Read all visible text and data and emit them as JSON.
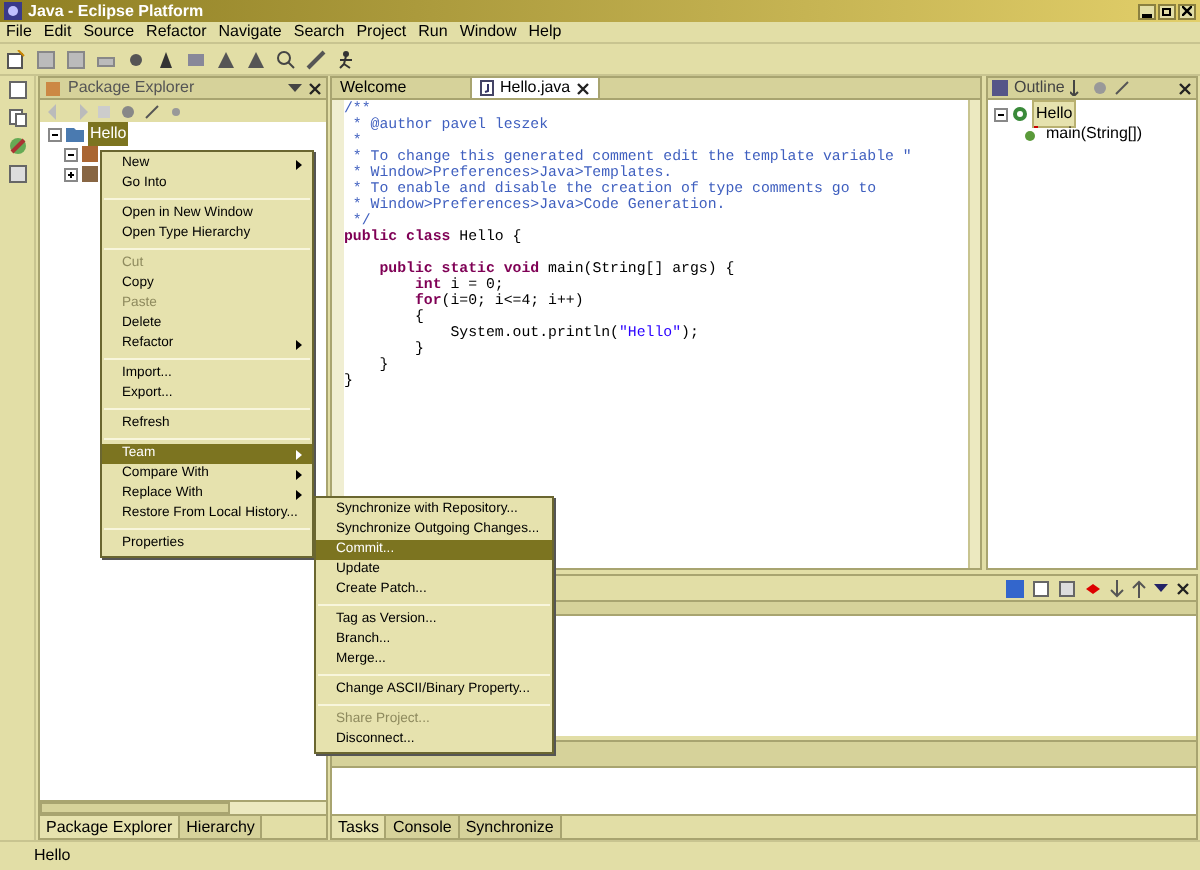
{
  "window": {
    "title": "Java - Eclipse Platform"
  },
  "menu_bar": [
    "File",
    "Edit",
    "Source",
    "Refactor",
    "Navigate",
    "Search",
    "Project",
    "Run",
    "Window",
    "Help"
  ],
  "package_explorer": {
    "title": "Package Explorer",
    "tree": [
      {
        "label": "Hello",
        "selected": true,
        "expanded": true
      }
    ],
    "tabs": [
      {
        "label": "Package Explorer",
        "selected": true
      },
      {
        "label": "Hierarchy",
        "selected": false
      }
    ]
  },
  "editor": {
    "tabs": [
      {
        "label": "Welcome",
        "selected": false
      },
      {
        "label": "Hello.java",
        "selected": true
      }
    ],
    "lines": [
      {
        "kind": "code",
        "segments": [
          {
            "kind": "comment",
            "text": "/**"
          }
        ]
      },
      {
        "kind": "code",
        "segments": [
          {
            "kind": "comment",
            "text": " * @author pavel leszek"
          }
        ]
      },
      {
        "kind": "code",
        "segments": [
          {
            "kind": "comment",
            "text": " *"
          }
        ]
      },
      {
        "kind": "code",
        "segments": [
          {
            "kind": "comment",
            "text": " * To change this generated comment edit the template variable \""
          }
        ]
      },
      {
        "kind": "code",
        "segments": [
          {
            "kind": "comment",
            "text": " * Window>Preferences>Java>Templates."
          }
        ]
      },
      {
        "kind": "code",
        "segments": [
          {
            "kind": "comment",
            "text": " * To enable and disable the creation of type comments go to"
          }
        ]
      },
      {
        "kind": "code",
        "segments": [
          {
            "kind": "comment",
            "text": " * Window>Preferences>Java>Code Generation."
          }
        ]
      },
      {
        "kind": "code",
        "segments": [
          {
            "kind": "comment",
            "text": " */"
          }
        ]
      },
      {
        "kind": "code",
        "segments": [
          {
            "kind": "keyword",
            "text": "public class"
          },
          {
            "kind": "plain",
            "text": " Hello {"
          }
        ]
      },
      {
        "kind": "blank"
      },
      {
        "kind": "code",
        "segments": [
          {
            "kind": "keyword",
            "text": "    public static void"
          },
          {
            "kind": "plain",
            "text": " main(String[] args) {"
          }
        ]
      },
      {
        "kind": "code",
        "segments": [
          {
            "kind": "keyword",
            "text": "        int"
          },
          {
            "kind": "plain",
            "text": " i = 0;"
          }
        ]
      },
      {
        "kind": "code",
        "segments": [
          {
            "kind": "keyword",
            "text": "        for"
          },
          {
            "kind": "plain",
            "text": "(i=0; i<=4; i++)"
          }
        ]
      },
      {
        "kind": "code",
        "segments": [
          {
            "kind": "plain",
            "text": "        {"
          }
        ]
      },
      {
        "kind": "code",
        "segments": [
          {
            "kind": "plain",
            "text": "            System.out.println("
          },
          {
            "kind": "string",
            "text": "\"Hello\""
          },
          {
            "kind": "plain",
            "text": ");"
          }
        ]
      },
      {
        "kind": "code",
        "segments": [
          {
            "kind": "plain",
            "text": "        }"
          }
        ]
      },
      {
        "kind": "code",
        "segments": [
          {
            "kind": "plain",
            "text": "    }"
          }
        ]
      },
      {
        "kind": "code",
        "segments": [
          {
            "kind": "plain",
            "text": "}"
          }
        ]
      }
    ]
  },
  "outline": {
    "title": "Outline",
    "tree": [
      {
        "label": "Hello",
        "selected": true,
        "children": [
          {
            "label": "main(String[])",
            "selected": false
          }
        ]
      }
    ]
  },
  "context_menu": [
    {
      "kind": "item",
      "label": "New",
      "submenu": true,
      "disabled": false,
      "selected": false
    },
    {
      "kind": "item",
      "label": "Go Into",
      "submenu": false,
      "disabled": false,
      "selected": false
    },
    {
      "kind": "separator"
    },
    {
      "kind": "item",
      "label": "Open in New Window",
      "submenu": false,
      "disabled": false,
      "selected": false
    },
    {
      "kind": "item",
      "label": "Open Type Hierarchy",
      "submenu": false,
      "disabled": false,
      "selected": false
    },
    {
      "kind": "separator"
    },
    {
      "kind": "item",
      "label": "Cut",
      "submenu": false,
      "disabled": true,
      "selected": false
    },
    {
      "kind": "item",
      "label": "Copy",
      "submenu": false,
      "disabled": false,
      "selected": false
    },
    {
      "kind": "item",
      "label": "Paste",
      "submenu": false,
      "disabled": true,
      "selected": false
    },
    {
      "kind": "item",
      "label": "Delete",
      "submenu": false,
      "disabled": false,
      "selected": false
    },
    {
      "kind": "item",
      "label": "Refactor",
      "submenu": true,
      "disabled": false,
      "selected": false
    },
    {
      "kind": "separator"
    },
    {
      "kind": "item",
      "label": "Import...",
      "submenu": false,
      "disabled": false,
      "selected": false
    },
    {
      "kind": "item",
      "label": "Export...",
      "submenu": false,
      "disabled": false,
      "selected": false
    },
    {
      "kind": "separator"
    },
    {
      "kind": "item",
      "label": "Refresh",
      "submenu": false,
      "disabled": false,
      "selected": false
    },
    {
      "kind": "separator"
    },
    {
      "kind": "item",
      "label": "Team",
      "submenu": true,
      "disabled": false,
      "selected": true
    },
    {
      "kind": "item",
      "label": "Compare With",
      "submenu": true,
      "disabled": false,
      "selected": false
    },
    {
      "kind": "item",
      "label": "Replace With",
      "submenu": true,
      "disabled": false,
      "selected": false
    },
    {
      "kind": "item",
      "label": "Restore From Local History...",
      "submenu": false,
      "disabled": false,
      "selected": false
    },
    {
      "kind": "separator"
    },
    {
      "kind": "item",
      "label": "Properties",
      "submenu": false,
      "disabled": false,
      "selected": false
    }
  ],
  "team_submenu": [
    {
      "kind": "item",
      "label": "Synchronize with Repository...",
      "disabled": false,
      "selected": false
    },
    {
      "kind": "item",
      "label": "Synchronize Outgoing Changes...",
      "disabled": false,
      "selected": false
    },
    {
      "kind": "item",
      "label": "Commit...",
      "disabled": false,
      "selected": true
    },
    {
      "kind": "item",
      "label": "Update",
      "disabled": false,
      "selected": false
    },
    {
      "kind": "item",
      "label": "Create Patch...",
      "disabled": false,
      "selected": false
    },
    {
      "kind": "separator"
    },
    {
      "kind": "item",
      "label": "Tag as Version...",
      "disabled": false,
      "selected": false
    },
    {
      "kind": "item",
      "label": "Branch...",
      "disabled": false,
      "selected": false
    },
    {
      "kind": "item",
      "label": "Merge...",
      "disabled": false,
      "selected": false
    },
    {
      "kind": "separator"
    },
    {
      "kind": "item",
      "label": "Change ASCII/Binary Property...",
      "disabled": false,
      "selected": false
    },
    {
      "kind": "separator"
    },
    {
      "kind": "item",
      "label": "Share Project...",
      "disabled": true,
      "selected": false
    },
    {
      "kind": "item",
      "label": "Disconnect...",
      "disabled": false,
      "selected": false
    }
  ],
  "bottom_panel": {
    "tabs": [
      {
        "label": "Tasks",
        "selected": true
      },
      {
        "label": "Console",
        "selected": false
      },
      {
        "label": "Synchronize",
        "selected": false
      }
    ]
  },
  "status_bar": "Hello"
}
